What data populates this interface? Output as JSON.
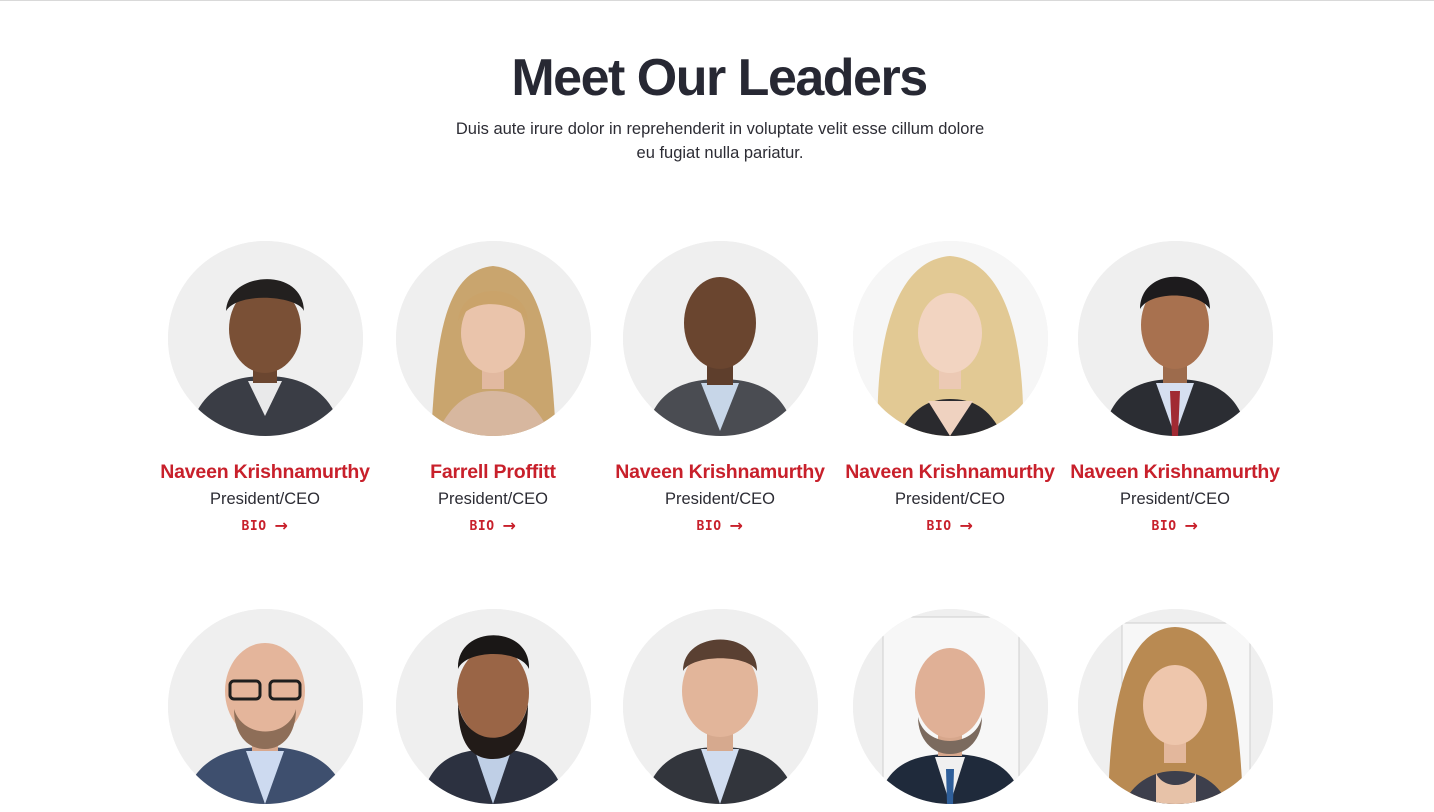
{
  "section": {
    "title": "Meet Our Leaders",
    "subtitle": "Duis aute irure dolor in reprehenderit in voluptate velit esse cillum dolore eu fugiat nulla pariatur."
  },
  "colors": {
    "accent": "#c8202b",
    "heading": "#272833",
    "text": "#2c2c34",
    "avatar_bg": "#efefef"
  },
  "leaders": [
    {
      "name": "Naveen Krishnamurthy",
      "title": "President/CEO",
      "link_label": "BIO",
      "link_icon": "arrow-right-icon"
    },
    {
      "name": "Farrell Proffitt",
      "title": "President/CEO",
      "link_label": "BIO",
      "link_icon": "arrow-right-icon"
    },
    {
      "name": "Naveen Krishnamurthy",
      "title": "President/CEO",
      "link_label": "BIO",
      "link_icon": "arrow-right-icon"
    },
    {
      "name": "Naveen Krishnamurthy",
      "title": "President/CEO",
      "link_label": "BIO",
      "link_icon": "arrow-right-icon"
    },
    {
      "name": "Naveen Krishnamurthy",
      "title": "President/CEO",
      "link_label": "BIO",
      "link_icon": "arrow-right-icon"
    },
    {
      "name": "",
      "title": "",
      "link_label": "",
      "link_icon": ""
    },
    {
      "name": "",
      "title": "",
      "link_label": "",
      "link_icon": ""
    },
    {
      "name": "",
      "title": "",
      "link_label": "",
      "link_icon": ""
    },
    {
      "name": "",
      "title": "",
      "link_label": "",
      "link_icon": ""
    },
    {
      "name": "",
      "title": "",
      "link_label": "",
      "link_icon": ""
    }
  ],
  "arrow_glyph": "→"
}
